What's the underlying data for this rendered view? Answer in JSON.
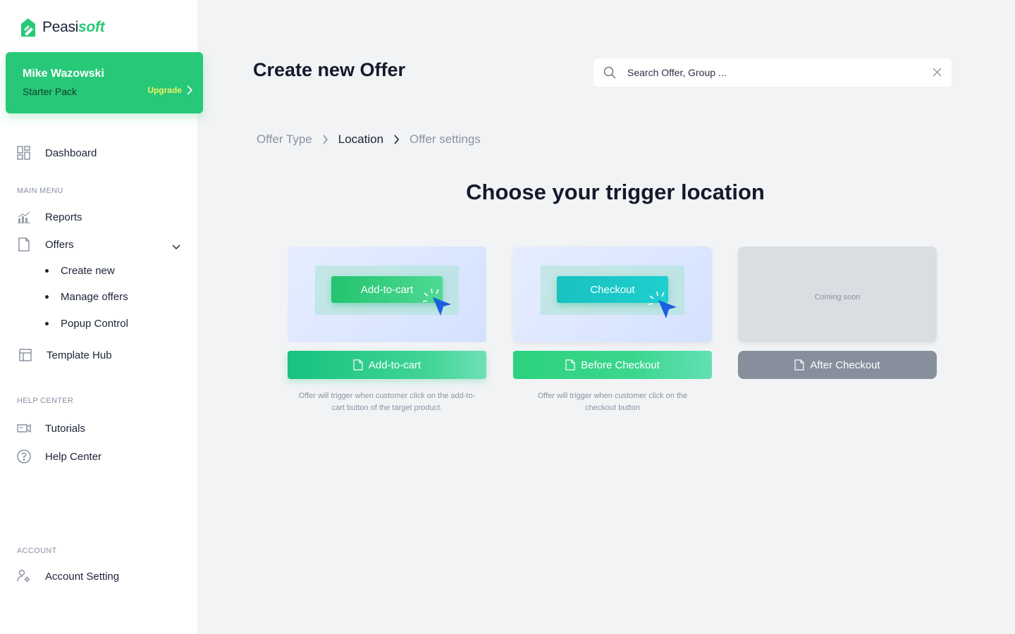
{
  "brand": {
    "name_part1": "Peasi",
    "name_part2": "soft",
    "accent": "#27c877"
  },
  "user": {
    "name": "Mike Wazowski",
    "plan": "Starter Pack",
    "upgrade_label": "Upgrade"
  },
  "sidebar": {
    "dashboard": "Dashboard",
    "main_menu_title": "MAIN MENU",
    "reports": "Reports",
    "offers": "Offers",
    "offers_sub": [
      "Create new",
      "Manage offers",
      "Popup Control"
    ],
    "template_hub": "Template Hub",
    "help_center_title": "HELP CENTER",
    "tutorials": "Tutorials",
    "help_center": "Help Center",
    "account_title": "ACCOUNT",
    "account_setting": "Account Setting"
  },
  "header": {
    "title": "Create new Offer",
    "search_placeholder": "Search Offer, Group ..."
  },
  "breadcrumb": [
    "Offer Type",
    "Location",
    "Offer settings"
  ],
  "heading": "Choose your trigger location",
  "cards": [
    {
      "preview_label": "Add-to-cart",
      "button": "Add-to-cart",
      "description": "Offer will trigger when customer click on the add-to-cart button of the target product."
    },
    {
      "preview_label": "Checkout",
      "button": "Before Checkout",
      "description": "Offer will trigger when customer click on the checkout button"
    },
    {
      "preview_label": "Coming soon",
      "button": "After Checkout",
      "description": ""
    }
  ]
}
